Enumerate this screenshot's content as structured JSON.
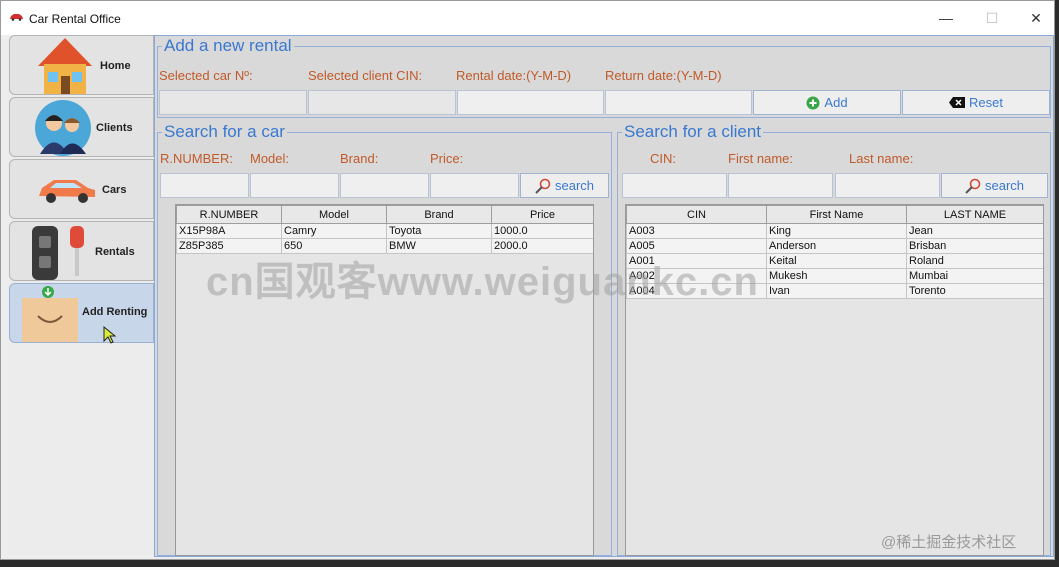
{
  "window": {
    "title": "Car Rental Office",
    "minimize": "—",
    "maximize": "☐",
    "close": "✕"
  },
  "sidebar": {
    "items": [
      {
        "label": "Home"
      },
      {
        "label": "Clients"
      },
      {
        "label": "Cars"
      },
      {
        "label": "Rentals"
      },
      {
        "label": "Add Renting"
      }
    ]
  },
  "add_rental": {
    "legend": "Add a new rental",
    "labels": {
      "car": "Selected car Nº:",
      "cin": "Selected client CIN:",
      "rental_date": "Rental date:(Y-M-D)",
      "return_date": "Return date:(Y-M-D)"
    },
    "values": {
      "car": "",
      "cin": "",
      "rental_date": "",
      "return_date": ""
    },
    "add_label": "Add",
    "reset_label": "Reset"
  },
  "car_search": {
    "legend": "Search for a car",
    "labels": {
      "rnumber": "R.NUMBER:",
      "model": "Model:",
      "brand": "Brand:",
      "price": "Price:"
    },
    "search_label": "search",
    "columns": [
      "R.NUMBER",
      "Model",
      "Brand",
      "Price"
    ],
    "rows": [
      [
        "X15P98A",
        "Camry",
        "Toyota",
        "1000.0"
      ],
      [
        "Z85P385",
        "650",
        "BMW",
        "2000.0"
      ]
    ]
  },
  "client_search": {
    "legend": "Search for a client",
    "labels": {
      "cin": "CIN:",
      "first": "First name:",
      "last": "Last name:"
    },
    "search_label": "search",
    "columns": [
      "CIN",
      "First Name",
      "LAST NAME"
    ],
    "rows": [
      [
        "A003",
        "King",
        "Jean"
      ],
      [
        "A005",
        "Anderson",
        "Brisban"
      ],
      [
        "A001",
        "Keital",
        "Roland"
      ],
      [
        "A002",
        "Mukesh",
        "Mumbai"
      ],
      [
        "A004",
        "Ivan",
        "Torento"
      ]
    ]
  },
  "watermarks": {
    "center": "cn国观客www.weiguankc.cn",
    "corner": "@稀土掘金技术社区"
  },
  "colors": {
    "accent": "#3a78d0",
    "label": "#c05a2a"
  }
}
